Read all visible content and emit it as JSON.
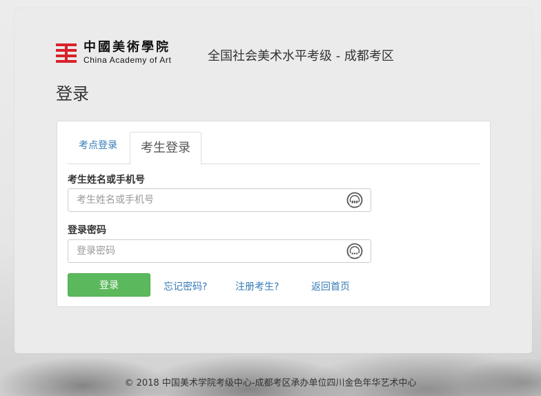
{
  "brand": {
    "logo_cn": "中國美術學院",
    "logo_en": "China Academy of Art",
    "site_title": "全国社会美术水平考级 - 成都考区"
  },
  "page": {
    "title": "登录"
  },
  "tabs": [
    {
      "label": "考点登录",
      "active": false
    },
    {
      "label": "考生登录",
      "active": true
    }
  ],
  "form": {
    "username": {
      "label": "考生姓名或手机号",
      "placeholder": "考生姓名或手机号",
      "value": ""
    },
    "password": {
      "label": "登录密码",
      "placeholder": "登录密码",
      "value": ""
    },
    "submit_label": "登录"
  },
  "links": {
    "forgot": "忘记密码?",
    "register": "注册考生?",
    "home": "返回首页"
  },
  "footer": {
    "text": "© 2018 中国美术学院考级中心-成都考区承办单位四川金色年华艺术中心"
  },
  "colors": {
    "primary_button": "#5cb85c",
    "link": "#337ab7",
    "logo_red": "#d9222a"
  }
}
